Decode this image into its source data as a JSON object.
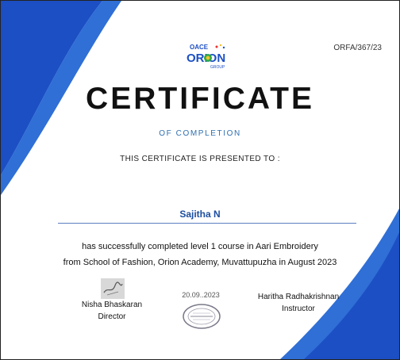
{
  "certificate": {
    "reference_number": "ORFA/367/23",
    "title": "CERTIFICATE",
    "subtitle": "OF COMPLETION",
    "presented_to": "THIS CERTIFICATE IS PRESENTED TO :",
    "recipient_name": "Sajitha N",
    "description_line1": "has successfully completed level 1 course in Aari Embroidery",
    "description_line2": "from School of Fashion, Orion Academy, Muvattupuzha in August 2023",
    "date": "20.09..2023"
  },
  "logo": {
    "top_text": "OACE",
    "main_text": "ORION",
    "small_text": "GROUP"
  },
  "signatories": {
    "left": {
      "name": "Nisha Bhaskaran",
      "role": "Director"
    },
    "right": {
      "name": "Haritha Radhakrishnan",
      "role": "Instructor"
    }
  },
  "colors": {
    "brand_blue": "#1c4fc4",
    "light_blue": "#2f6fd6",
    "accent_text": "#2f6fb0"
  }
}
